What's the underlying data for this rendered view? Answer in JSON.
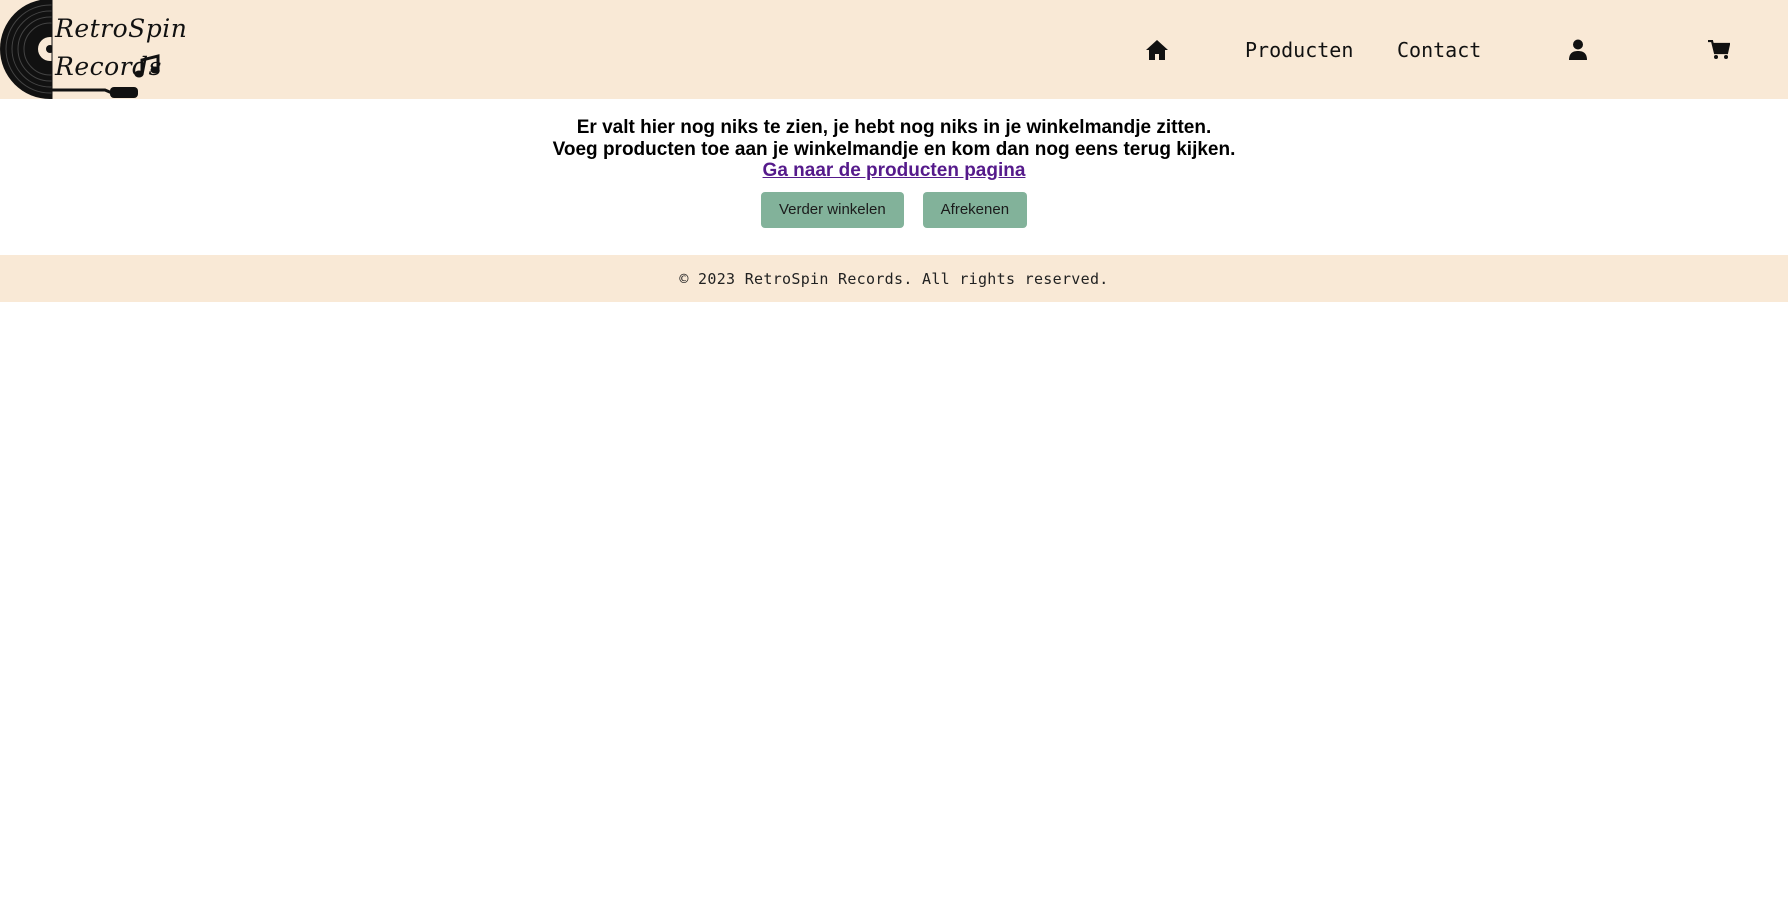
{
  "header": {
    "logo": {
      "line1": "RetroSpin",
      "line2": "Records"
    },
    "nav": {
      "home_icon": "home-icon",
      "products_label": "Producten",
      "contact_label": "Contact",
      "account_icon": "user-icon",
      "cart_icon": "cart-icon"
    }
  },
  "cart": {
    "empty_message_line1": "Er valt hier nog niks te zien, je hebt nog niks in je winkelmandje zitten.",
    "empty_message_line2": "Voeg producten toe aan je winkelmandje en kom dan nog eens terug kijken.",
    "products_link": "Ga naar de producten pagina",
    "continue_button": "Verder winkelen",
    "checkout_button": "Afrekenen"
  },
  "footer": {
    "copyright": "© 2023 RetroSpin Records. All rights reserved."
  },
  "colors": {
    "header_bg": "#f9e9d6",
    "button_bg": "#82b29a",
    "link": "#551a8b"
  }
}
